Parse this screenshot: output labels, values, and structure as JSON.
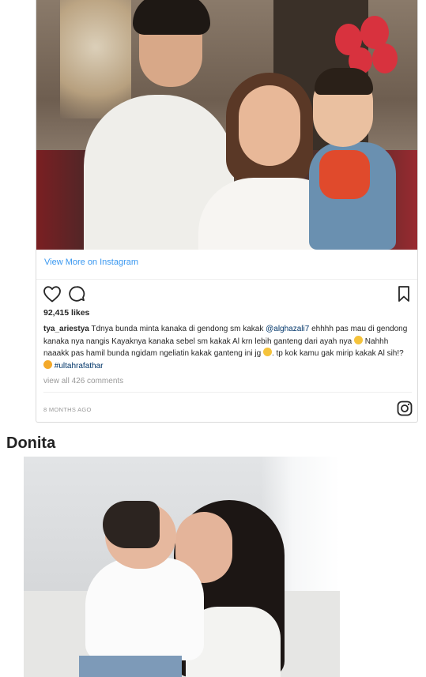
{
  "instagram_post": {
    "view_more_label": "View More on Instagram",
    "likes": "92,415 likes",
    "caption": {
      "username": "tya_ariestya",
      "text_1": " Tdnya bunda minta kanaka di gendong sm kakak ",
      "mention": "@alghazali7",
      "text_2": " ehhhh pas mau di gendong kanaka nya nangis Kayaknya kanaka sebel sm kakak Al krn lebih ganteng dari ayah nya ",
      "text_3": " Nahhh naaakk pas hamil bunda ngidam ngeliatin kakak ganteng ini jg ",
      "text_4": ". tp kok kamu gak mirip kakak Al sih!? ",
      "hashtag": "#ultahrafathar"
    },
    "view_comments_label": "view all 426 comments",
    "timestamp": "8 MONTHS AGO",
    "icons": {
      "like": "heart-icon",
      "comment": "comment-icon",
      "save": "bookmark-icon",
      "brand": "instagram-logo-icon"
    },
    "colors": {
      "link": "#3897f0",
      "mention": "#003569",
      "muted": "#999999"
    }
  },
  "section": {
    "heading": "Donita"
  }
}
